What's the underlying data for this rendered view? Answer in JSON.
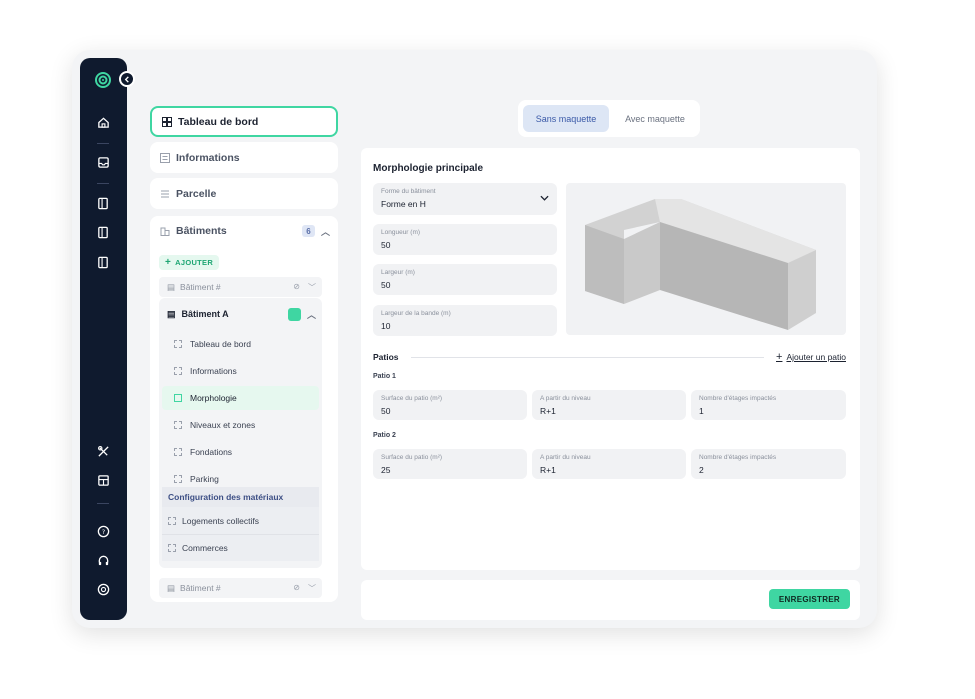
{
  "nav": {
    "dashboard": "Tableau de bord",
    "informations": "Informations",
    "parcelle": "Parcelle",
    "batiments": "Bâtiments",
    "batiments_count": "6",
    "add_label": "AJOUTER",
    "building_placeholder_1": "Bâtiment #",
    "building_active": "Bâtiment A",
    "building_placeholder_2": "Bâtiment #",
    "sub_items": [
      "Tableau de bord",
      "Informations",
      "Morphologie",
      "Niveaux et zones",
      "Fondations",
      "Parking"
    ],
    "config_title": "Configuration des matériaux",
    "materials": [
      "Logements collectifs",
      "Commerces"
    ]
  },
  "toggle": {
    "without": "Sans maquette",
    "with": "Avec maquette"
  },
  "main": {
    "title": "Morphologie principale",
    "shape_label": "Forme du bâtiment",
    "shape_value": "Forme en H",
    "length_label": "Longueur (m)",
    "length_value": "50",
    "width_label": "Largeur (m)",
    "width_value": "50",
    "band_label": "Largeur de la bande (m)",
    "band_value": "10",
    "patios_title": "Patios",
    "add_patio": "Ajouter un patio",
    "patio_fields": {
      "surface_label": "Surface du patio (m²)",
      "level_label": "A partir du niveau",
      "floors_label": "Nombre d'étages impactés"
    },
    "patios": [
      {
        "title": "Patio 1",
        "surface": "50",
        "level": "R+1",
        "floors": "1"
      },
      {
        "title": "Patio 2",
        "surface": "25",
        "level": "R+1",
        "floors": "2"
      }
    ]
  },
  "footer": {
    "save": "ENREGISTRER"
  },
  "colors": {
    "rail": "#0f1a2e",
    "accent": "#3fd6a2",
    "toggle_active": "#dde6f5"
  }
}
